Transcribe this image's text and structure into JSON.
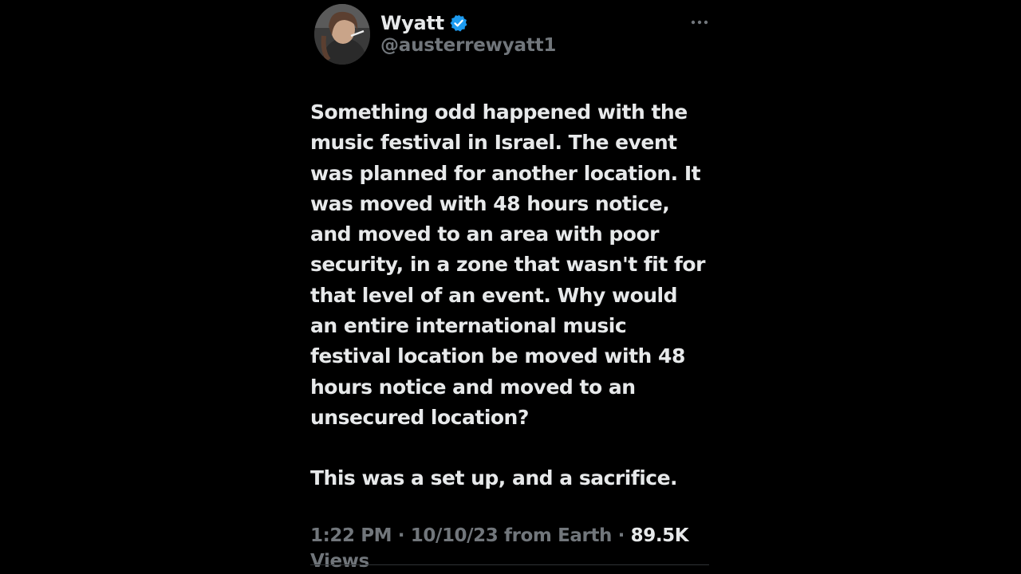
{
  "tweet": {
    "display_name": "Wyatt",
    "handle": "@austerrewyatt1",
    "avatar_icon": "user-avatar-photo",
    "verified_icon": "verified-badge-icon",
    "verified_color": "#1d9bf0",
    "more_icon": "more-options-icon",
    "body_paragraph_1": "Something odd happened with the music festival in Israel. The event was planned for another location. It was moved with 48 hours notice, and moved to an area with poor security, in a zone that wasn't fit for that level of an event. Why would an entire international music festival location be moved with 48 hours notice and moved to an unsecured location?",
    "body_paragraph_2": "This was a set up, and a sacrifice.",
    "time": "1:22 PM",
    "separator": " · ",
    "date": "10/10/23",
    "source": "from Earth",
    "views_count": "89.5K",
    "views_label": "Views"
  }
}
